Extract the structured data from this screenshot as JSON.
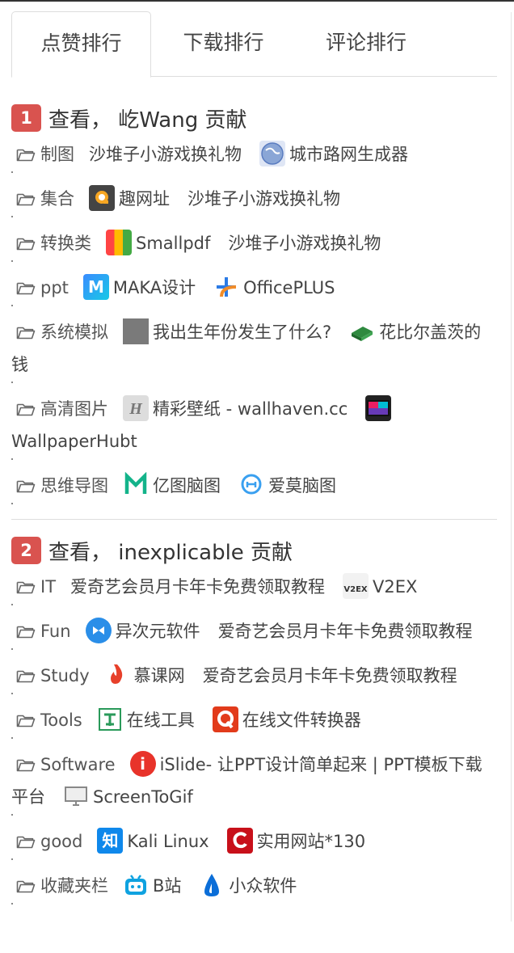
{
  "tabs": [
    "点赞排行",
    "下载排行",
    "评论排行"
  ],
  "sections": [
    {
      "rank": "1",
      "title": "查看， 屹Wang 贡献",
      "categories": [
        {
          "name": "制图",
          "links": [
            {
              "text": "沙堆子小游戏换礼物",
              "icon": ""
            },
            {
              "text": "城市路网生成器",
              "icon": "globe-icon"
            }
          ]
        },
        {
          "name": "集合",
          "links": [
            {
              "text": "趣网址",
              "icon": "qu-icon"
            },
            {
              "text": "沙堆子小游戏换礼物",
              "icon": ""
            }
          ]
        },
        {
          "name": "转换类",
          "links": [
            {
              "text": "Smallpdf",
              "icon": "smallpdf-icon"
            },
            {
              "text": "沙堆子小游戏换礼物",
              "icon": ""
            }
          ]
        },
        {
          "name": "ppt",
          "links": [
            {
              "text": "MAKA设计",
              "icon": "maka-icon"
            },
            {
              "text": "OfficePLUS",
              "icon": "officeplus-icon"
            }
          ]
        },
        {
          "name": "系统模拟",
          "links": [
            {
              "text": "我出生年份发生了什么?",
              "icon": "gray-square-icon"
            },
            {
              "text": "花比尔盖茨的钱",
              "icon": "money-icon"
            }
          ]
        },
        {
          "name": "高清图片",
          "links": [
            {
              "text": "精彩壁纸 - wallhaven.cc",
              "icon": "wallhaven-icon"
            },
            {
              "text": "WallpaperHubt",
              "icon": "wallpaperhub-icon"
            }
          ]
        },
        {
          "name": "思维导图",
          "links": [
            {
              "text": "亿图脑图",
              "icon": "edraw-icon"
            },
            {
              "text": "爱莫脑图",
              "icon": "aimo-icon"
            }
          ]
        }
      ]
    },
    {
      "rank": "2",
      "title": "查看， inexplicable 贡献",
      "categories": [
        {
          "name": "IT",
          "links": [
            {
              "text": "爱奇艺会员月卡年卡免费领取教程",
              "icon": ""
            },
            {
              "text": "V2EX",
              "icon": "v2ex-icon"
            }
          ]
        },
        {
          "name": "Fun",
          "links": [
            {
              "text": "异次元软件",
              "icon": "iplaysoft-icon"
            },
            {
              "text": "爱奇艺会员月卡年卡免费领取教程",
              "icon": ""
            }
          ]
        },
        {
          "name": "Study",
          "links": [
            {
              "text": "慕课网",
              "icon": "imooc-icon"
            },
            {
              "text": "爱奇艺会员月卡年卡免费领取教程",
              "icon": ""
            }
          ]
        },
        {
          "name": "Tools",
          "links": [
            {
              "text": "在线工具",
              "icon": "tool-icon"
            },
            {
              "text": "在线文件转换器",
              "icon": "convert-icon"
            }
          ]
        },
        {
          "name": "Software",
          "links": [
            {
              "text": "iSlide- 让PPT设计简单起来 | PPT模板下载平台",
              "icon": "islide-icon"
            },
            {
              "text": "ScreenToGif",
              "icon": "monitor-icon"
            }
          ]
        },
        {
          "name": "good",
          "links": [
            {
              "text": "Kali Linux",
              "icon": "zhihu-icon"
            },
            {
              "text": "实用网站*130",
              "icon": "c-icon"
            }
          ]
        },
        {
          "name": "收藏夹栏",
          "links": [
            {
              "text": "B站",
              "icon": "bilibili-icon"
            },
            {
              "text": "小众软件",
              "icon": "appinn-icon"
            }
          ]
        }
      ]
    }
  ]
}
